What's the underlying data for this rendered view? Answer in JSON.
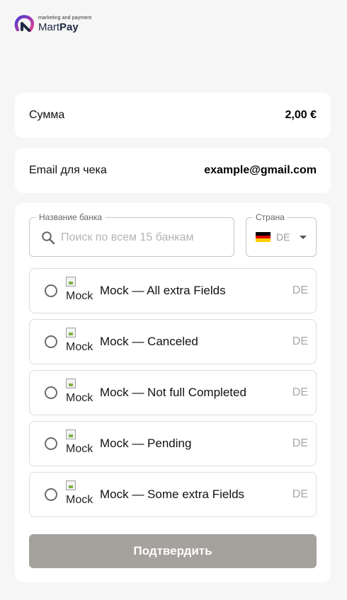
{
  "brand": {
    "tagline": "marketing and payment",
    "name_light": "Mart",
    "name_bold": "Pay",
    "colors": {
      "logo_gradient_start": "#4b3bd6",
      "logo_gradient_end": "#e63a8c"
    }
  },
  "summary": {
    "amount_label": "Сумма",
    "amount_value": "2,00 €",
    "email_label": "Email для чека",
    "email_value": "example@gmail.com"
  },
  "bank_search": {
    "legend": "Название банка",
    "placeholder": "Поиск по всем 15 банкам",
    "value": "",
    "icon": "search-icon"
  },
  "country_select": {
    "legend": "Страна",
    "selected_code": "DE",
    "flag": "germany-flag",
    "icon": "chevron-down-icon"
  },
  "banks": [
    {
      "name": "Mock — All extra Fields",
      "logo_alt": "Mock",
      "country": "DE",
      "selected": false
    },
    {
      "name": "Mock — Canceled",
      "logo_alt": "Mock",
      "country": "DE",
      "selected": false
    },
    {
      "name": "Mock — Not full Completed",
      "logo_alt": "Mock",
      "country": "DE",
      "selected": false
    },
    {
      "name": "Mock — Pending",
      "logo_alt": "Mock",
      "country": "DE",
      "selected": false
    },
    {
      "name": "Mock — Some extra Fields",
      "logo_alt": "Mock",
      "country": "DE",
      "selected": false
    }
  ],
  "confirm": {
    "label": "Подтвердить",
    "enabled": false,
    "color": "#a5a19d"
  }
}
